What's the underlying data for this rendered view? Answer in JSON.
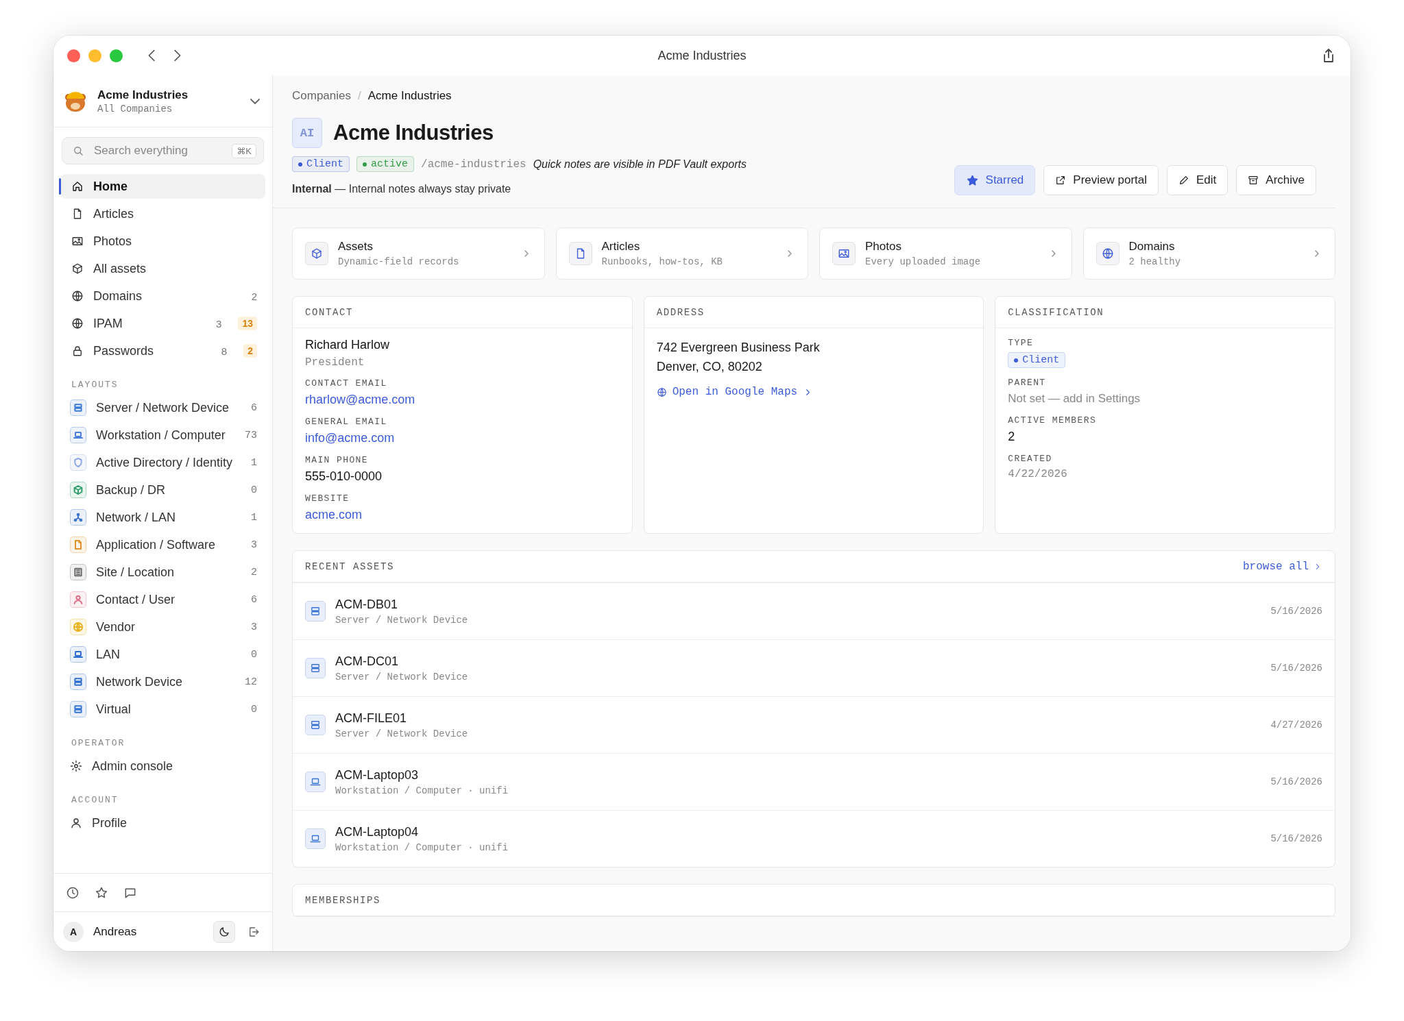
{
  "window": {
    "title": "Acme Industries"
  },
  "sidebar": {
    "company": {
      "name": "Acme Industries",
      "subtitle": "All Companies"
    },
    "search": {
      "placeholder": "Search everything",
      "shortcut": "⌘K"
    },
    "nav": [
      {
        "label": "Home",
        "kind": "home",
        "selected": true
      },
      {
        "label": "Articles",
        "kind": "document",
        "selected": false
      },
      {
        "label": "Photos",
        "kind": "image",
        "selected": false
      },
      {
        "label": "All assets",
        "kind": "box",
        "selected": false
      },
      {
        "label": "Domains",
        "kind": "globe",
        "selected": false,
        "count": "2"
      },
      {
        "label": "IPAM",
        "kind": "globe",
        "selected": false,
        "count": "3",
        "alert": "13"
      },
      {
        "label": "Passwords",
        "kind": "lock",
        "selected": false,
        "count": "8",
        "alert": "2"
      }
    ],
    "layouts_heading": "LAYOUTS",
    "layouts": [
      {
        "label": "Server / Network Device",
        "kind": "server",
        "color": "#3a7bd5",
        "count": "6"
      },
      {
        "label": "Workstation / Computer",
        "kind": "laptop",
        "color": "#4c7fd8",
        "count": "73"
      },
      {
        "label": "Active Directory / Identity",
        "kind": "shield",
        "color": "#8fa8e6",
        "count": "1"
      },
      {
        "label": "Backup / DR",
        "kind": "box",
        "color": "#2f9e6b",
        "count": "0"
      },
      {
        "label": "Network / LAN",
        "kind": "network",
        "color": "#3b74d1",
        "count": "1"
      },
      {
        "label": "Application / Software",
        "kind": "document",
        "color": "#e0922a",
        "count": "3"
      },
      {
        "label": "Site / Location",
        "kind": "site",
        "color": "#6b6b6b",
        "count": "2"
      },
      {
        "label": "Contact / User",
        "kind": "contact",
        "color": "#e0708a",
        "count": "6"
      },
      {
        "label": "Vendor",
        "kind": "globe",
        "color": "#e8b21c",
        "count": "3"
      },
      {
        "label": "LAN",
        "kind": "laptop",
        "color": "#2f6fd0",
        "count": "0"
      },
      {
        "label": "Network Device",
        "kind": "server",
        "color": "#2f6fd0",
        "count": "12"
      },
      {
        "label": "Virtual",
        "kind": "server",
        "color": "#3578d6",
        "count": "0"
      }
    ],
    "sections": [
      {
        "heading": "OPERATOR",
        "items": [
          {
            "label": "Admin console",
            "kind": "gear"
          }
        ]
      },
      {
        "heading": "ACCOUNT",
        "items": [
          {
            "label": "Profile",
            "kind": "user"
          }
        ]
      }
    ],
    "user": {
      "initial": "A",
      "name": "Andreas"
    }
  },
  "main": {
    "breadcrumb": [
      "Companies",
      "Acme Industries"
    ],
    "breadcrumb_separator": "/",
    "header": {
      "initials": "AI",
      "title": "Acme Industries",
      "tags": [
        {
          "label": "Client",
          "color": "#3b5bdb"
        },
        {
          "label": "active",
          "color": "#2f9e44"
        }
      ],
      "slug": "/acme-industries",
      "note": "Quick notes are visible in PDF Vault exports",
      "internal": "**Internal** — Internal notes always stay private",
      "actions": [
        {
          "label": "Starred",
          "kind": "star",
          "selected": true
        },
        {
          "label": "Preview portal",
          "kind": "external",
          "selected": false
        },
        {
          "label": "Edit",
          "kind": "pencil",
          "selected": false
        },
        {
          "label": "Archive",
          "kind": "archive",
          "selected": false
        }
      ]
    },
    "quick_links": [
      {
        "title": "Assets",
        "subtitle": "Dynamic-field records",
        "kind": "box"
      },
      {
        "title": "Articles",
        "subtitle": "Runbooks, how-tos, KB",
        "kind": "document"
      },
      {
        "title": "Photos",
        "subtitle": "Every uploaded image",
        "kind": "image"
      },
      {
        "title": "Domains",
        "subtitle": "2 healthy",
        "kind": "globe"
      }
    ],
    "contact": {
      "heading": "CONTACT",
      "name": "Richard Harlow",
      "role": "President",
      "fields": [
        {
          "label": "CONTACT EMAIL",
          "value": "rharlow@acme.com",
          "kind": "link"
        },
        {
          "label": "GENERAL EMAIL",
          "value": "info@acme.com",
          "kind": "link"
        },
        {
          "label": "MAIN PHONE",
          "value": "555-010-0000",
          "kind": "text"
        },
        {
          "label": "WEBSITE",
          "value": "acme.com",
          "kind": "link"
        }
      ]
    },
    "address": {
      "heading": "ADDRESS",
      "lines": [
        "742 Evergreen Business Park",
        "Denver, CO, 80202"
      ],
      "map_link": "Open in Google Maps"
    },
    "classification": {
      "heading": "CLASSIFICATION",
      "fields": [
        {
          "label": "TYPE",
          "value": "Client",
          "kind": "tag"
        },
        {
          "label": "PARENT",
          "value": "Not set — add in Settings",
          "kind": "muted"
        },
        {
          "label": "ACTIVE MEMBERS",
          "value": "2",
          "kind": "text"
        },
        {
          "label": "CREATED",
          "value": "4/22/2026",
          "kind": "date"
        }
      ]
    },
    "recent_assets": {
      "heading": "RECENT ASSETS",
      "browse": "browse all",
      "rows": [
        {
          "name": "ACM-DB01",
          "subtitle": "Server / Network Device",
          "date": "5/16/2026",
          "kind": "server"
        },
        {
          "name": "ACM-DC01",
          "subtitle": "Server / Network Device",
          "date": "5/16/2026",
          "kind": "server"
        },
        {
          "name": "ACM-FILE01",
          "subtitle": "Server / Network Device",
          "date": "4/27/2026",
          "kind": "server"
        },
        {
          "name": "ACM-Laptop03",
          "subtitle": "Workstation / Computer · unifi",
          "date": "5/16/2026",
          "kind": "laptop"
        },
        {
          "name": "ACM-Laptop04",
          "subtitle": "Workstation / Computer · unifi",
          "date": "5/16/2026",
          "kind": "laptop"
        }
      ]
    },
    "memberships": {
      "heading": "MEMBERSHIPS"
    }
  }
}
